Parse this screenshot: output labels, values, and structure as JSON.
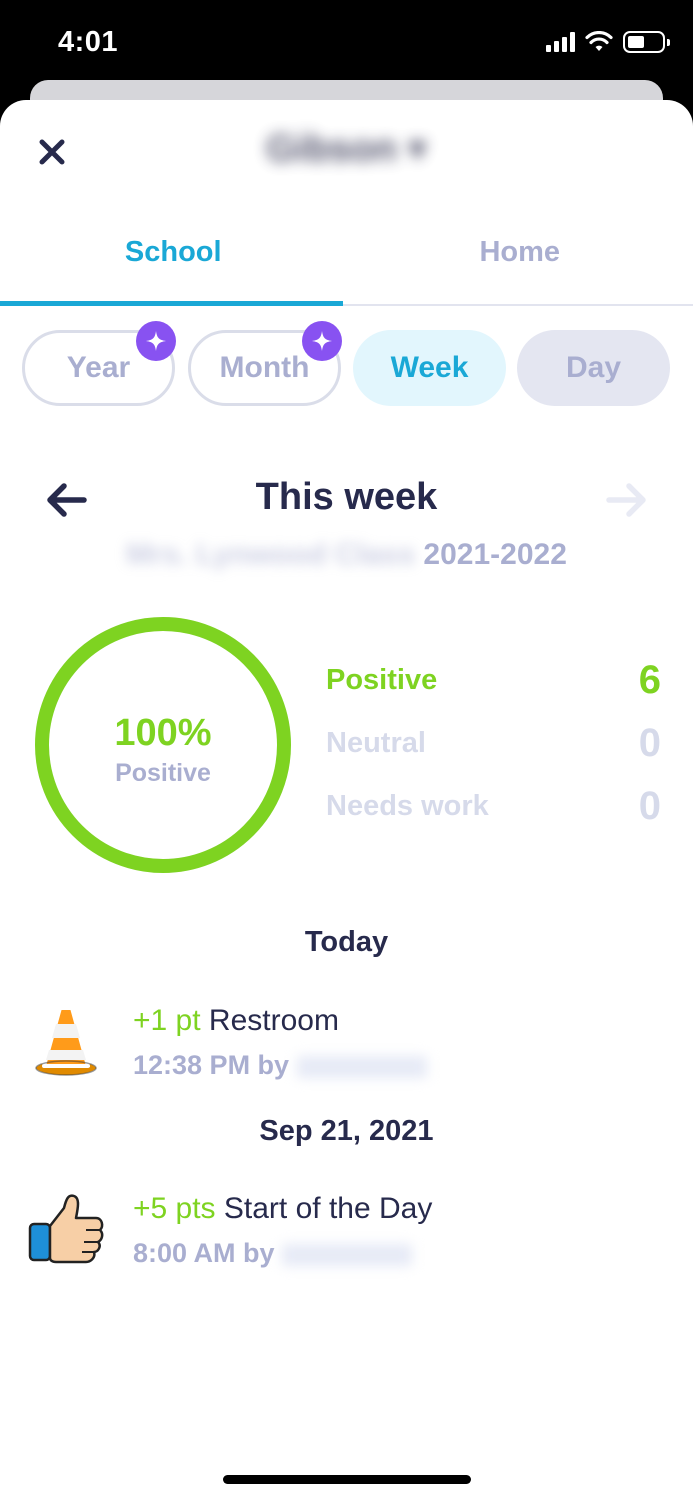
{
  "status_bar": {
    "time": "4:01"
  },
  "header": {
    "student_name": "Gibson"
  },
  "tabs": [
    {
      "label": "School",
      "active": true
    },
    {
      "label": "Home",
      "active": false
    }
  ],
  "range_chips": [
    {
      "label": "Year",
      "premium": true,
      "state": "outline"
    },
    {
      "label": "Month",
      "premium": true,
      "state": "outline"
    },
    {
      "label": "Week",
      "premium": false,
      "state": "selected"
    },
    {
      "label": "Day",
      "premium": false,
      "state": "disabled"
    }
  ],
  "period": {
    "title": "This week",
    "class_name": "Mrs. Lynwood Class",
    "school_year": "2021-2022"
  },
  "summary": {
    "percent": "100%",
    "percent_label": "Positive",
    "positive_label": "Positive",
    "positive_count": "6",
    "neutral_label": "Neutral",
    "neutral_count": "0",
    "needs_work_label": "Needs work",
    "needs_work_count": "0"
  },
  "chart_data": {
    "type": "pie",
    "categories": [
      "Positive",
      "Neutral",
      "Needs work"
    ],
    "values": [
      6,
      0,
      0
    ]
  },
  "feed": [
    {
      "section": "Today",
      "entries": [
        {
          "icon": "traffic-cone-icon",
          "points": "+1 pt",
          "title": "Restroom",
          "time_by": "12:38 PM by",
          "teacher": "Mrs. Foster"
        }
      ]
    },
    {
      "section": "Sep 21, 2021",
      "entries": [
        {
          "icon": "thumbs-up-icon",
          "points": "+5 pts",
          "title": "Start of the Day",
          "time_by": "8:00 AM by",
          "teacher": "Mrs. Foster"
        }
      ]
    }
  ],
  "colors": {
    "accent": "#1aa8d6",
    "positive": "#7ed321",
    "premium": "#8852f1",
    "muted": "#a9aed0",
    "dark_text": "#272a4c"
  }
}
